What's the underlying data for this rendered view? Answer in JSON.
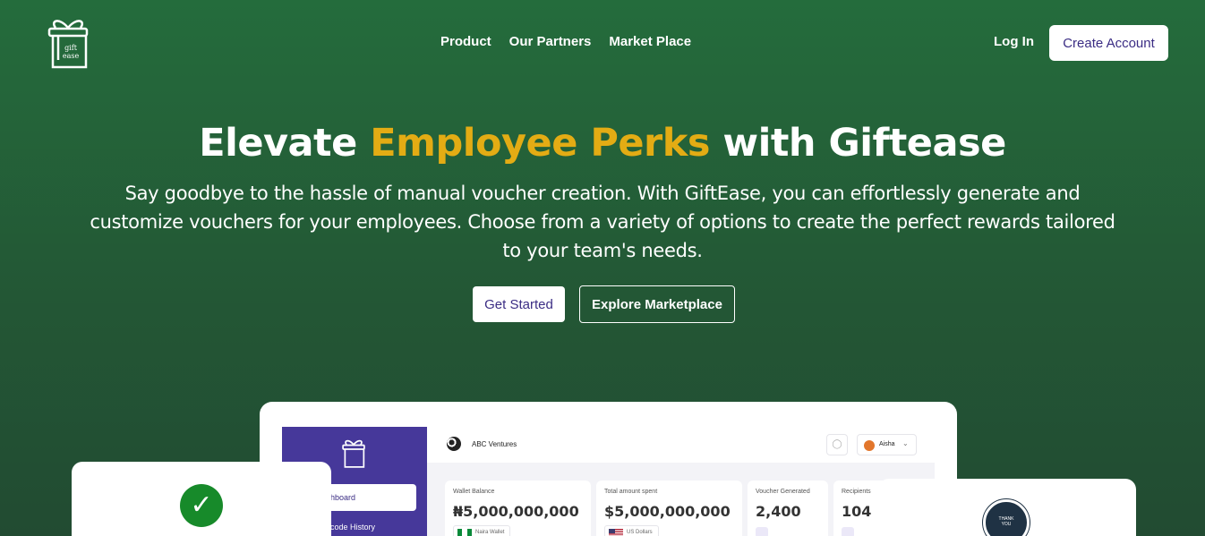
{
  "brand": {
    "logo_text_top": "gift",
    "logo_text_bottom": "ease"
  },
  "nav": {
    "items": [
      "Product",
      "Our Partners",
      "Market Place"
    ]
  },
  "auth": {
    "login": "Log In",
    "create_account": "Create Account"
  },
  "hero": {
    "title_part1": "Elevate",
    "title_highlight": "Employee Perks",
    "title_part2": "with Giftease",
    "subtitle": "Say goodbye to the hassle of manual voucher creation. With GiftEase, you can effortlessly generate and customize vouchers for your employees. Choose from a variety of options to create the perfect rewards tailored to your team's needs.",
    "cta_primary": "Get Started",
    "cta_secondary": "Explore Marketplace",
    "highlight_color": "#e3ac14"
  },
  "dashboard": {
    "company": "ABC Ventures",
    "user": "Aisha",
    "menu": [
      "hboard",
      "code History"
    ],
    "cards": [
      {
        "label": "Wallet Balance",
        "value": "₦5,000,000,000",
        "sub": "Naira Wallet"
      },
      {
        "label": "Total amount spent",
        "value": "$5,000,000,000",
        "sub": "US Dollars"
      },
      {
        "label": "Voucher Generated",
        "value": "2,400"
      },
      {
        "label": "Recipients",
        "value": "104"
      }
    ]
  },
  "badge": {
    "line1": "THANK",
    "line2": "YOU"
  },
  "colors": {
    "brand_purple": "#46389a",
    "button_text": "#3b2d84",
    "success": "#178a2a"
  }
}
